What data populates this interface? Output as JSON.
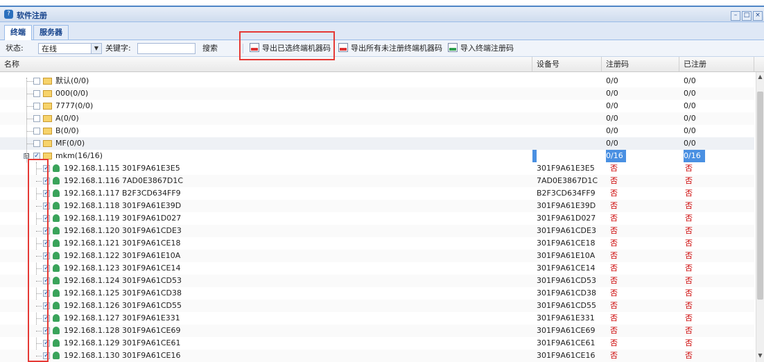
{
  "window": {
    "title": "软件注册"
  },
  "tabs": [
    {
      "label": "终端"
    },
    {
      "label": "服务器"
    }
  ],
  "toolbar": {
    "status_label": "状态:",
    "status_value": "在线",
    "keyword_label": "关键字:",
    "keyword_value": "",
    "search_label": "搜索",
    "export_selected": "导出已选终端机器码",
    "export_unregistered": "导出所有未注册终端机器码",
    "import_codes": "导入终端注册码"
  },
  "columns": {
    "name": "名称",
    "device": "设备号",
    "regcode": "注册码",
    "registered": "已注册"
  },
  "groups": [
    {
      "name": "默认(0/0)",
      "reg": "0/0",
      "done": "0/0"
    },
    {
      "name": "000(0/0)",
      "reg": "0/0",
      "done": "0/0"
    },
    {
      "name": "7777(0/0)",
      "reg": "0/0",
      "done": "0/0"
    },
    {
      "name": "A(0/0)",
      "reg": "0/0",
      "done": "0/0"
    },
    {
      "name": "B(0/0)",
      "reg": "0/0",
      "done": "0/0"
    },
    {
      "name": "MF(0/0)",
      "reg": "0/0",
      "done": "0/0"
    },
    {
      "name": "mkm(16/16)",
      "reg": "0/16",
      "done": "0/16",
      "expanded": "⊟"
    }
  ],
  "terminals": [
    {
      "name": "192.168.1.115 301F9A61E3E5",
      "device": "301F9A61E3E5",
      "reg": "否",
      "done": "否"
    },
    {
      "name": "192.168.1.116 7AD0E3867D1C",
      "device": "7AD0E3867D1C",
      "reg": "否",
      "done": "否"
    },
    {
      "name": "192.168.1.117 B2F3CD634FF9",
      "device": "B2F3CD634FF9",
      "reg": "否",
      "done": "否"
    },
    {
      "name": "192.168.1.118 301F9A61E39D",
      "device": "301F9A61E39D",
      "reg": "否",
      "done": "否"
    },
    {
      "name": "192.168.1.119 301F9A61D027",
      "device": "301F9A61D027",
      "reg": "否",
      "done": "否"
    },
    {
      "name": "192.168.1.120 301F9A61CDE3",
      "device": "301F9A61CDE3",
      "reg": "否",
      "done": "否"
    },
    {
      "name": "192.168.1.121 301F9A61CE18",
      "device": "301F9A61CE18",
      "reg": "否",
      "done": "否"
    },
    {
      "name": "192.168.1.122 301F9A61E10A",
      "device": "301F9A61E10A",
      "reg": "否",
      "done": "否"
    },
    {
      "name": "192.168.1.123 301F9A61CE14",
      "device": "301F9A61CE14",
      "reg": "否",
      "done": "否"
    },
    {
      "name": "192.168.1.124 301F9A61CD53",
      "device": "301F9A61CD53",
      "reg": "否",
      "done": "否"
    },
    {
      "name": "192.168.1.125 301F9A61CD38",
      "device": "301F9A61CD38",
      "reg": "否",
      "done": "否"
    },
    {
      "name": "192.168.1.126 301F9A61CD55",
      "device": "301F9A61CD55",
      "reg": "否",
      "done": "否"
    },
    {
      "name": "192.168.1.127 301F9A61E331",
      "device": "301F9A61E331",
      "reg": "否",
      "done": "否"
    },
    {
      "name": "192.168.1.128 301F9A61CE69",
      "device": "301F9A61CE69",
      "reg": "否",
      "done": "否"
    },
    {
      "name": "192.168.1.129 301F9A61CE61",
      "device": "301F9A61CE61",
      "reg": "否",
      "done": "否"
    },
    {
      "name": "192.168.1.130 301F9A61CE16",
      "device": "301F9A61CE16",
      "reg": "否",
      "done": "否"
    }
  ],
  "colors": {
    "accent": "#15428b",
    "highlight": "#4a90e2",
    "annotation": "#e53935",
    "no_text": "#cc0000"
  }
}
